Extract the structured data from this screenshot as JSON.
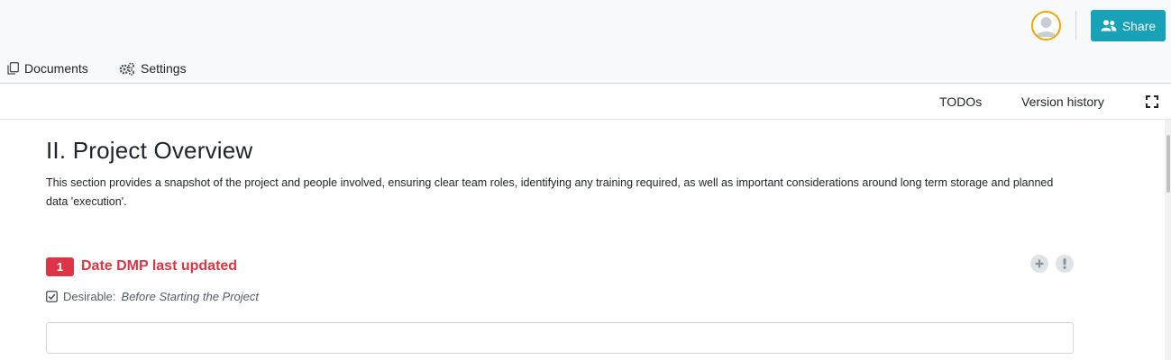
{
  "header": {
    "share_label": "Share"
  },
  "nav": {
    "items": [
      {
        "label": "Documents",
        "icon": "documents-icon"
      },
      {
        "label": "Settings",
        "icon": "gears-icon"
      }
    ]
  },
  "toolbar": {
    "todos_label": "TODOs",
    "version_history_label": "Version history"
  },
  "chapter": {
    "title": "II. Project Overview",
    "description": "This section provides a snapshot of the project and people involved, ensuring clear team roles, identifying any training required, as well as important considerations around long term storage and planned data 'execution'."
  },
  "question": {
    "number": "1",
    "title": "Date DMP last updated",
    "requirement_prefix": "Desirable:",
    "requirement_level": "Before Starting the Project",
    "answer_value": "",
    "answer_placeholder": ""
  },
  "colors": {
    "accent": "#17a2b8",
    "danger": "#dc3545",
    "avatar_ring": "#f0a500"
  }
}
